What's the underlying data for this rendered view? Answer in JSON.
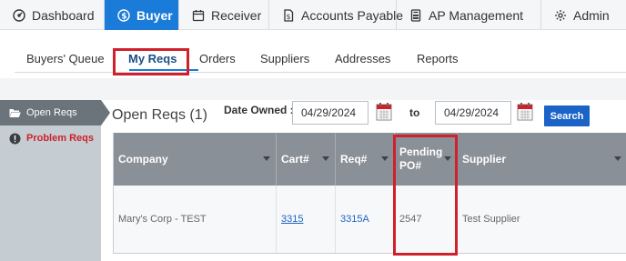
{
  "topnav": {
    "tabs": [
      {
        "label": "Dashboard",
        "icon": "dashboard-icon",
        "active": false
      },
      {
        "label": "Buyer",
        "icon": "dollar-circle-icon",
        "active": true
      },
      {
        "label": "Receiver",
        "icon": "calendar-icon",
        "active": false
      },
      {
        "label": "Accounts Payable",
        "icon": "invoice-dollar-icon",
        "active": false
      },
      {
        "label": "AP Management",
        "icon": "calculator-icon",
        "active": false
      },
      {
        "label": "Admin",
        "icon": "gear-icon",
        "active": false
      }
    ]
  },
  "subnav": {
    "items": [
      {
        "label": "Buyers' Queue",
        "active": false
      },
      {
        "label": "My Reqs",
        "active": true
      },
      {
        "label": "Orders",
        "active": false
      },
      {
        "label": "Suppliers",
        "active": false
      },
      {
        "label": "Addresses",
        "active": false
      },
      {
        "label": "Reports",
        "active": false
      }
    ]
  },
  "sidebar": {
    "items": [
      {
        "label": "Open Reqs",
        "icon": "folder-open-icon",
        "active": true
      },
      {
        "label": "Problem Reqs",
        "icon": "alert-circle-icon",
        "active": false
      }
    ]
  },
  "page": {
    "title": "Open Reqs (1)",
    "date_owned_label": "Date Owned :",
    "date_from": "04/29/2024",
    "to_label": "to",
    "date_to": "04/29/2024",
    "search_label": "Search"
  },
  "table": {
    "columns": [
      "Company",
      "Cart#",
      "Req#",
      "Pending PO#",
      "Supplier"
    ],
    "rows": [
      {
        "company": "Mary's Corp - TEST",
        "cart": "3315",
        "req": "3315A",
        "pending_po": "2547",
        "supplier": "Test Supplier"
      }
    ]
  },
  "colors": {
    "active_tab": "#1b7bd8",
    "header_bg": "#8a9097",
    "highlight_box": "#d0202b",
    "search_button": "#1b63c6"
  }
}
